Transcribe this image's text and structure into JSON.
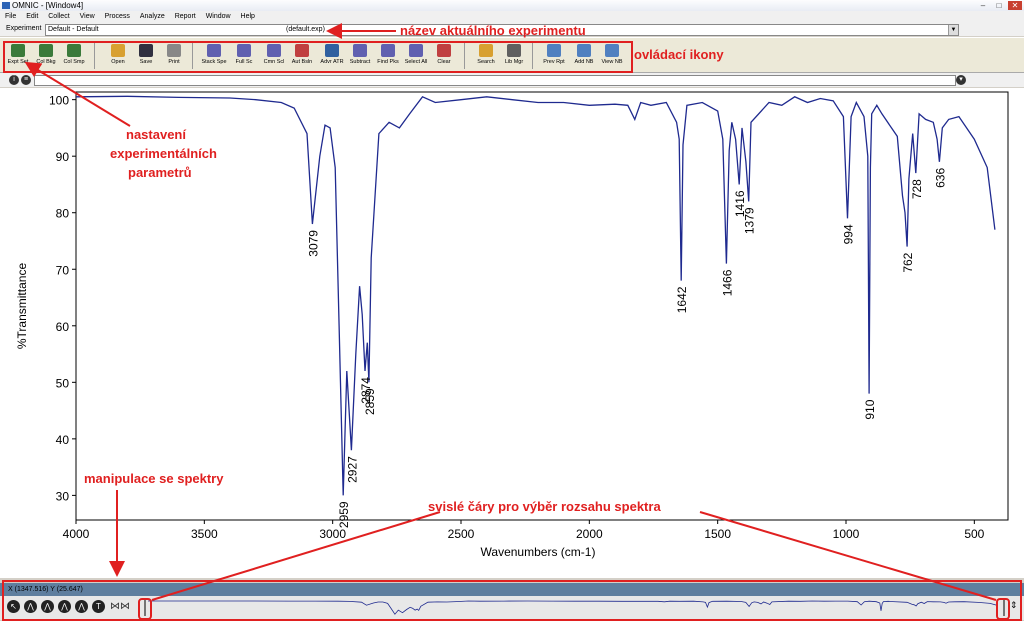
{
  "window": {
    "title": "OMNIC - [Window4]",
    "minimize": "–",
    "maximize": "□",
    "close": "✕"
  },
  "menu": [
    "File",
    "Edit",
    "Collect",
    "View",
    "Process",
    "Analyze",
    "Report",
    "Window",
    "Help"
  ],
  "experiment": {
    "label": "Experiment",
    "value": "Default - Default",
    "file": "(default.exp)"
  },
  "toolbar": [
    {
      "label": "Expt Set",
      "icon": "expt-set-icon",
      "color": "#3a7a3a"
    },
    {
      "label": "Col Bkg",
      "icon": "collect-background-icon",
      "color": "#3a7a3a"
    },
    {
      "label": "Col Smp",
      "icon": "collect-sample-icon",
      "color": "#3a7a3a"
    },
    {
      "label": "Open",
      "icon": "open-folder-icon",
      "color": "#d8a030"
    },
    {
      "label": "Save",
      "icon": "save-disk-icon",
      "color": "#303040"
    },
    {
      "label": "Print",
      "icon": "printer-icon",
      "color": "#888888"
    },
    {
      "label": "Stack Spe",
      "icon": "stack-spectra-icon",
      "color": "#6060b0"
    },
    {
      "label": "Full Sc",
      "icon": "full-scale-icon",
      "color": "#6060b0"
    },
    {
      "label": "Cmn Scl",
      "icon": "common-scale-icon",
      "color": "#6060b0"
    },
    {
      "label": "Aut Bsln",
      "icon": "auto-baseline-icon",
      "color": "#c04040"
    },
    {
      "label": "Advr ATR",
      "icon": "advanced-atr-icon",
      "color": "#3060a0"
    },
    {
      "label": "Subtract",
      "icon": "subtract-icon",
      "color": "#6060b0"
    },
    {
      "label": "Find Pks",
      "icon": "find-peaks-icon",
      "color": "#6060b0"
    },
    {
      "label": "Select All",
      "icon": "select-all-icon",
      "color": "#6060b0"
    },
    {
      "label": "Clear",
      "icon": "clear-icon",
      "color": "#c04040"
    },
    {
      "label": "Search",
      "icon": "search-icon",
      "color": "#d8a030"
    },
    {
      "label": "Lib Mgr",
      "icon": "library-manager-icon",
      "color": "#606060"
    },
    {
      "label": "Prev Rpt",
      "icon": "preview-report-icon",
      "color": "#5080c0"
    },
    {
      "label": "Add NB",
      "icon": "add-notebook-icon",
      "color": "#5080c0"
    },
    {
      "label": "View NB",
      "icon": "view-notebook-icon",
      "color": "#5080c0"
    }
  ],
  "status": {
    "coords": "X (1347.516) Y (25.647)"
  },
  "chart_data": {
    "type": "line",
    "xlabel": "Wavenumbers (cm-1)",
    "ylabel": "%Transmittance",
    "xlim": [
      4000,
      400
    ],
    "ylim": [
      26,
      101
    ],
    "x_ticks": [
      "4000",
      "3500",
      "3000",
      "2500",
      "2000",
      "1500",
      "1000",
      "500"
    ],
    "y_ticks": [
      "30",
      "40",
      "50",
      "60",
      "70",
      "80",
      "90",
      "100"
    ],
    "grid": false,
    "series_color": "#1f2a8f",
    "x": [
      4000,
      3800,
      3600,
      3400,
      3300,
      3200,
      3150,
      3100,
      3079,
      3050,
      3030,
      3010,
      2990,
      2975,
      2959,
      2945,
      2927,
      2910,
      2895,
      2885,
      2874,
      2865,
      2859,
      2850,
      2820,
      2780,
      2740,
      2700,
      2650,
      2600,
      2500,
      2400,
      2300,
      2200,
      2100,
      2000,
      1900,
      1850,
      1823,
      1800,
      1760,
      1700,
      1660,
      1650,
      1642,
      1635,
      1620,
      1560,
      1500,
      1480,
      1466,
      1455,
      1445,
      1430,
      1416,
      1405,
      1390,
      1379,
      1370,
      1300,
      1250,
      1200,
      1150,
      1100,
      1050,
      1010,
      994,
      980,
      960,
      930,
      915,
      910,
      905,
      900,
      880,
      860,
      800,
      780,
      770,
      762,
      755,
      740,
      728,
      715,
      690,
      660,
      645,
      636,
      625,
      600,
      560,
      500,
      450,
      420
    ],
    "y": [
      100.5,
      100.6,
      100.4,
      100.3,
      100.0,
      99.5,
      98.5,
      94.0,
      78.0,
      90.0,
      95.5,
      95.0,
      88.0,
      60.0,
      30.0,
      52.0,
      38.0,
      55.0,
      67.0,
      62.0,
      52.0,
      57.0,
      50.0,
      72.0,
      94.0,
      96.0,
      95.0,
      97.5,
      100.5,
      99.5,
      100.0,
      100.5,
      100.0,
      99.5,
      99.5,
      99.0,
      99.2,
      99.0,
      96.5,
      99.5,
      99.0,
      99.5,
      96.0,
      93.0,
      68.0,
      92.0,
      99.0,
      99.5,
      98.0,
      93.0,
      71.0,
      91.0,
      96.0,
      93.0,
      85.0,
      95.0,
      89.0,
      82.0,
      96.0,
      99.5,
      99.0,
      100.5,
      99.5,
      100.2,
      99.8,
      97.0,
      79.0,
      97.0,
      99.5,
      97.0,
      90.0,
      48.0,
      88.0,
      97.5,
      99.0,
      97.5,
      93.5,
      83.0,
      80.0,
      74.0,
      86.0,
      94.0,
      87.0,
      97.5,
      96.5,
      96.0,
      93.0,
      89.0,
      95.0,
      96.5,
      97.0,
      93.0,
      88.0,
      77.0
    ],
    "peaks": [
      {
        "x": 3079,
        "y": 78,
        "label": "3079"
      },
      {
        "x": 2959,
        "y": 30,
        "label": "2959"
      },
      {
        "x": 2927,
        "y": 38,
        "label": "2927"
      },
      {
        "x": 2874,
        "y": 52,
        "label": "2874"
      },
      {
        "x": 2859,
        "y": 50,
        "label": "2859"
      },
      {
        "x": 1642,
        "y": 68,
        "label": "1642"
      },
      {
        "x": 1466,
        "y": 71,
        "label": "1466"
      },
      {
        "x": 1416,
        "y": 85,
        "label": "1416"
      },
      {
        "x": 1379,
        "y": 82,
        "label": "1379"
      },
      {
        "x": 994,
        "y": 79,
        "label": "994"
      },
      {
        "x": 910,
        "y": 48,
        "label": "910"
      },
      {
        "x": 762,
        "y": 74,
        "label": "762"
      },
      {
        "x": 728,
        "y": 87,
        "label": "728"
      },
      {
        "x": 636,
        "y": 89,
        "label": "636"
      }
    ]
  },
  "annotations": {
    "experiment_name": "název aktuálního experimentu",
    "control_icons": "ovládací ikony",
    "params_1": "nastavení",
    "params_2": "experimentálních",
    "params_3": "parametrů",
    "spectra_manipulation": "manipulace se spektry",
    "vertical_lines": "svislé čáry pro výběr rozsahu spektra",
    "color": "#e02020"
  }
}
